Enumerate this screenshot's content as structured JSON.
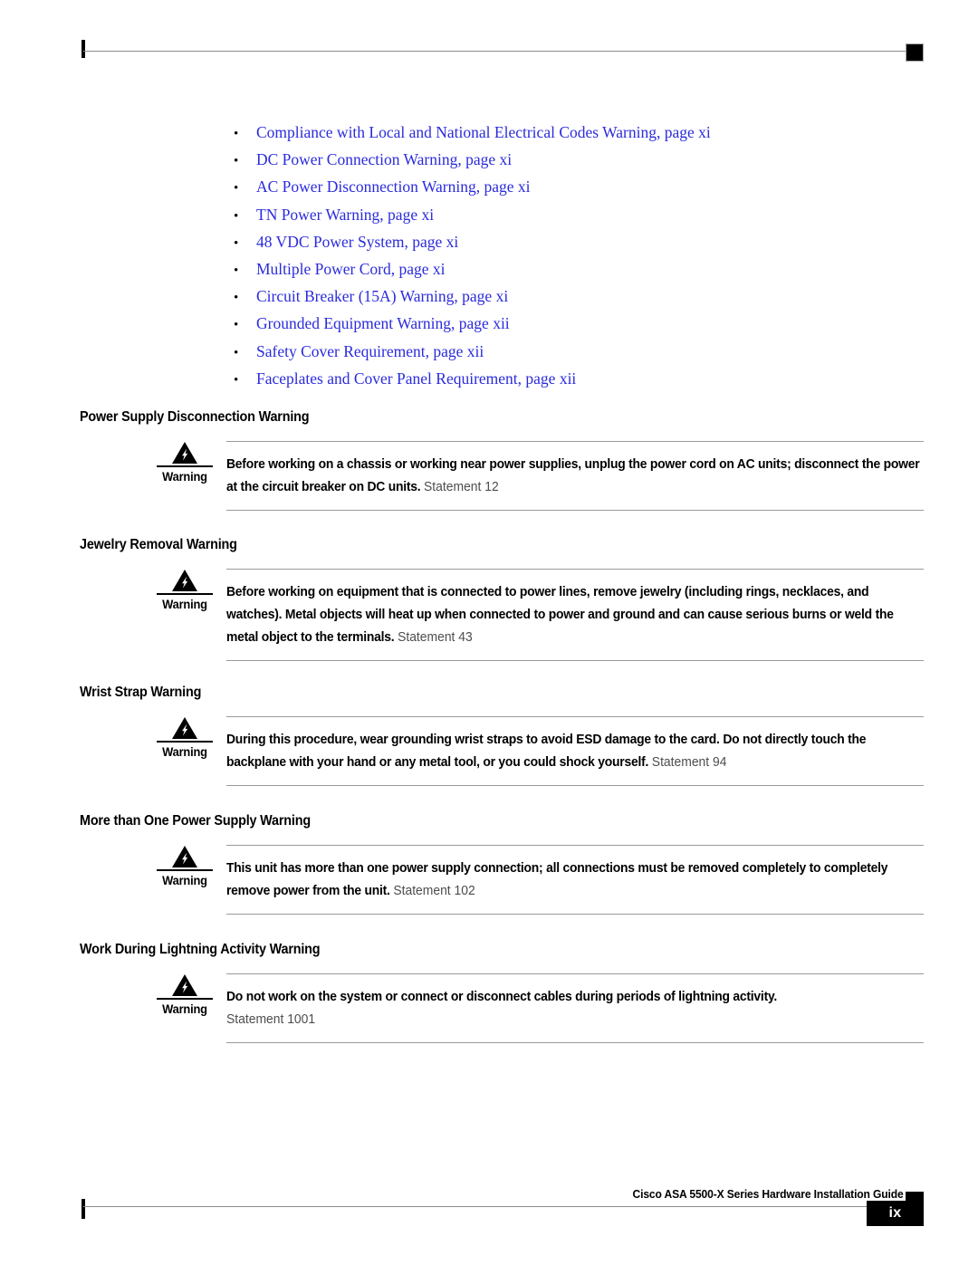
{
  "page": {
    "number": "ix",
    "footer_title": "Cisco ASA 5500-X Series Hardware Installation Guide"
  },
  "xref_list": {
    "bullet_glyph": "•",
    "items": [
      {
        "label": "Compliance with Local and National Electrical Codes Warning, page xi"
      },
      {
        "label": "DC Power Connection Warning, page xi"
      },
      {
        "label": "AC Power Disconnection Warning, page xi"
      },
      {
        "label": "TN Power Warning, page xi"
      },
      {
        "label": "48 VDC Power System, page xi"
      },
      {
        "label": "Multiple Power Cord, page xi"
      },
      {
        "label": "Circuit Breaker (15A) Warning, page xi"
      },
      {
        "label": "Grounded Equipment Warning, page xii"
      },
      {
        "label": "Safety Cover Requirement, page xii"
      },
      {
        "label": "Faceplates and Cover Panel Requirement, page xii"
      }
    ]
  },
  "sections": [
    {
      "heading": "Power Supply Disconnection Warning",
      "warning_label": "Warning",
      "text": "Before working on a chassis or working near power supplies, unplug the power cord on AC units; disconnect the power at the circuit breaker on DC units.",
      "statement": "Statement 12",
      "statement_own_line": false
    },
    {
      "heading": "Jewelry Removal Warning",
      "warning_label": "Warning",
      "text": "Before working on equipment that is connected to power lines, remove jewelry (including rings, necklaces, and watches). Metal objects will heat up when connected to power and ground and can cause serious burns or weld the metal object to the terminals.",
      "statement": "Statement 43",
      "statement_own_line": false
    },
    {
      "heading": "Wrist Strap Warning",
      "warning_label": "Warning",
      "text": "During this procedure, wear grounding wrist straps to avoid ESD damage to the card. Do not directly touch the backplane with your hand or any metal tool, or you could shock yourself.",
      "statement": "Statement 94",
      "statement_own_line": false
    },
    {
      "heading": "More than One Power Supply Warning",
      "warning_label": "Warning",
      "text": "This unit has more than one power supply connection; all connections must be removed completely to completely remove power from the unit.",
      "statement": "Statement 102",
      "statement_own_line": false
    },
    {
      "heading": "Work During Lightning Activity Warning",
      "warning_label": "Warning",
      "text": "Do not work on the system or connect or disconnect cables during periods of lightning activity.",
      "statement": "Statement 1001",
      "statement_own_line": true
    }
  ],
  "colors": {
    "link": "#2b2bdd",
    "rule": "#9a9a9a",
    "statement": "#4d4d4d",
    "page_number_bg": "#000000"
  },
  "icons": {
    "warning": "warning-triangle-lightning-icon"
  }
}
